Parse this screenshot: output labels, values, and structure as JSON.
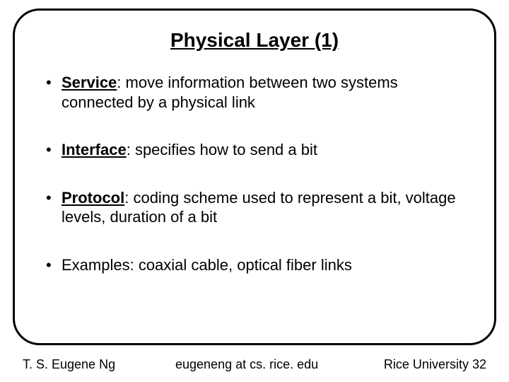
{
  "title": "Physical Layer (1)",
  "bullets": [
    {
      "term": "Service",
      "text": ": move information between two systems connected by a physical link"
    },
    {
      "term": "Interface",
      "text": ": specifies how to send a bit"
    },
    {
      "term": "Protocol",
      "text": ": coding scheme used to represent a bit, voltage levels, duration of a bit"
    },
    {
      "term": "",
      "text": "Examples: coaxial cable, optical fiber links"
    }
  ],
  "footer": {
    "author": "T. S. Eugene Ng",
    "email": "eugeneng at cs. rice. edu",
    "affiliation": "Rice University",
    "page": "32"
  }
}
